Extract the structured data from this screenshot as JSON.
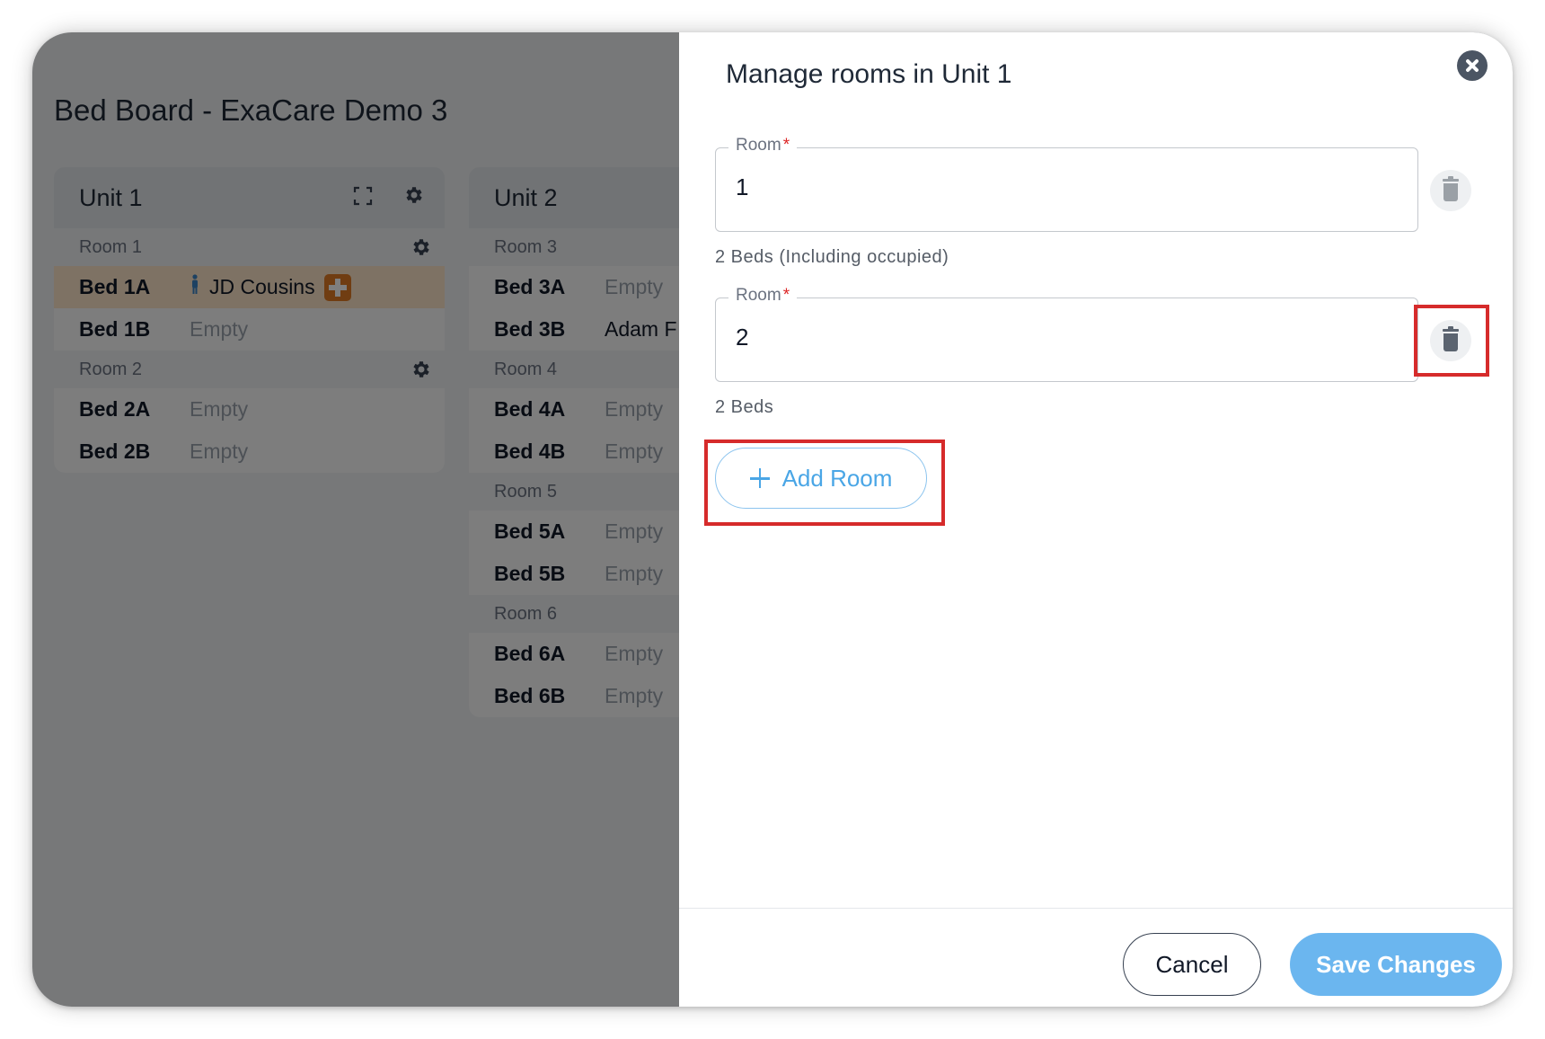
{
  "app": {
    "page_title": "Bed Board - ExaCare Demo 3",
    "units": [
      {
        "name": "Unit 1",
        "rooms": [
          {
            "label": "Room 1",
            "beds": [
              {
                "name": "Bed 1A",
                "status": "JD Cousins",
                "occupied": true
              },
              {
                "name": "Bed 1B",
                "status": "Empty",
                "occupied": false
              }
            ]
          },
          {
            "label": "Room 2",
            "beds": [
              {
                "name": "Bed 2A",
                "status": "Empty",
                "occupied": false
              },
              {
                "name": "Bed 2B",
                "status": "Empty",
                "occupied": false
              }
            ]
          }
        ]
      },
      {
        "name": "Unit 2",
        "rooms": [
          {
            "label": "Room 3",
            "beds": [
              {
                "name": "Bed 3A",
                "status": "Empty",
                "occupied": false
              },
              {
                "name": "Bed 3B",
                "status": "Adam F",
                "occupied": false
              }
            ]
          },
          {
            "label": "Room 4",
            "beds": [
              {
                "name": "Bed 4A",
                "status": "Empty",
                "occupied": false
              },
              {
                "name": "Bed 4B",
                "status": "Empty",
                "occupied": false
              }
            ]
          },
          {
            "label": "Room 5",
            "beds": [
              {
                "name": "Bed 5A",
                "status": "Empty",
                "occupied": false
              },
              {
                "name": "Bed 5B",
                "status": "Empty",
                "occupied": false
              }
            ]
          },
          {
            "label": "Room 6",
            "beds": [
              {
                "name": "Bed 6A",
                "status": "Empty",
                "occupied": false
              },
              {
                "name": "Bed 6B",
                "status": "Empty",
                "occupied": false
              }
            ]
          }
        ]
      }
    ]
  },
  "drawer": {
    "title": "Manage rooms in Unit 1",
    "rooms": [
      {
        "label": "Room",
        "required_mark": "*",
        "value": "1",
        "beds_note": "2 Beds (Including occupied)",
        "delete_enabled": false
      },
      {
        "label": "Room",
        "required_mark": "*",
        "value": "2",
        "beds_note": "2 Beds",
        "delete_enabled": true
      }
    ],
    "add_room_label": "Add Room",
    "cancel_label": "Cancel",
    "save_label": "Save Changes"
  },
  "colors": {
    "accent": "#6bb6ef",
    "highlight": "#d62b2b",
    "occupied_row": "#fde4c8",
    "medical_badge": "#e07b24"
  },
  "icons": [
    "expand-icon",
    "gear-icon",
    "person-icon",
    "medical-plus-icon",
    "close-icon",
    "trash-icon",
    "plus-icon"
  ]
}
